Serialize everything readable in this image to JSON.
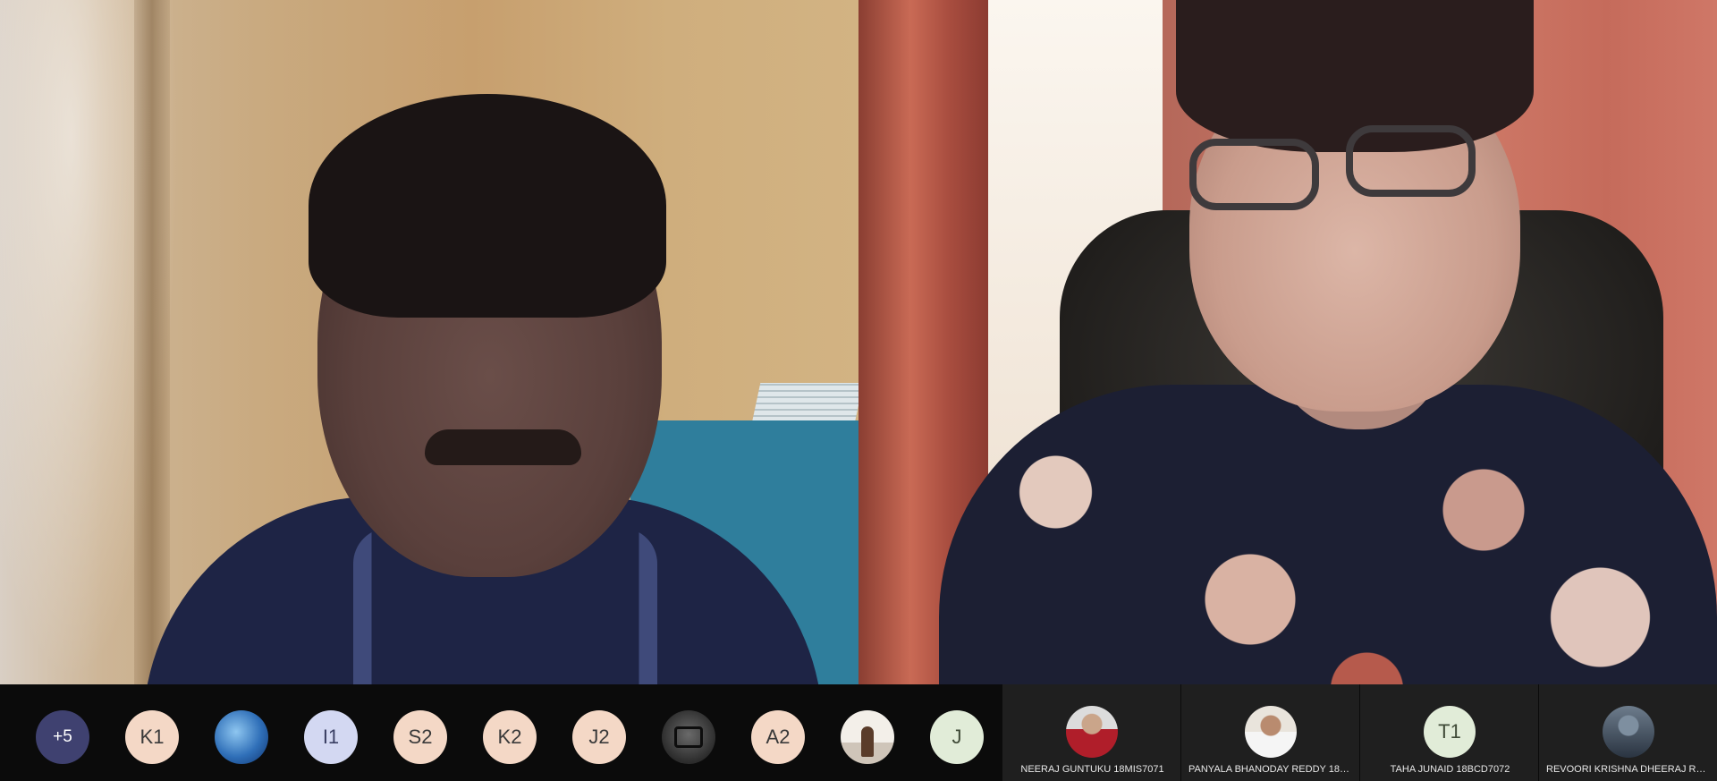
{
  "participants_strip": {
    "overflow_count": "+5",
    "avatars": [
      {
        "type": "initials",
        "text": "K1"
      },
      {
        "type": "photo",
        "icon": "ocean-photo-icon"
      },
      {
        "type": "initials",
        "text": "I1"
      },
      {
        "type": "initials",
        "text": "S2"
      },
      {
        "type": "initials",
        "text": "K2"
      },
      {
        "type": "initials",
        "text": "J2"
      },
      {
        "type": "photo",
        "icon": "camera-photo-icon"
      },
      {
        "type": "initials",
        "text": "A2"
      },
      {
        "type": "photo",
        "icon": "person-photo-icon"
      },
      {
        "type": "initials",
        "text": "J"
      }
    ],
    "named_tiles": [
      {
        "name": "NEERAJ GUNTUKU 18MIS7071",
        "avatar": "photo"
      },
      {
        "name": "PANYALA BHANODAY REDDY 18MI...",
        "avatar": "photo"
      },
      {
        "name": "TAHA JUNAID 18BCD7072",
        "avatar": "initials",
        "initials": "T1"
      },
      {
        "name": "REVOORI KRISHNA DHEERAJ REDD...",
        "avatar": "photo"
      }
    ]
  },
  "colors": {
    "strip_background": "#0b0b0b",
    "tile_background": "#1f1f1f",
    "overflow_badge": "#3f4170"
  }
}
